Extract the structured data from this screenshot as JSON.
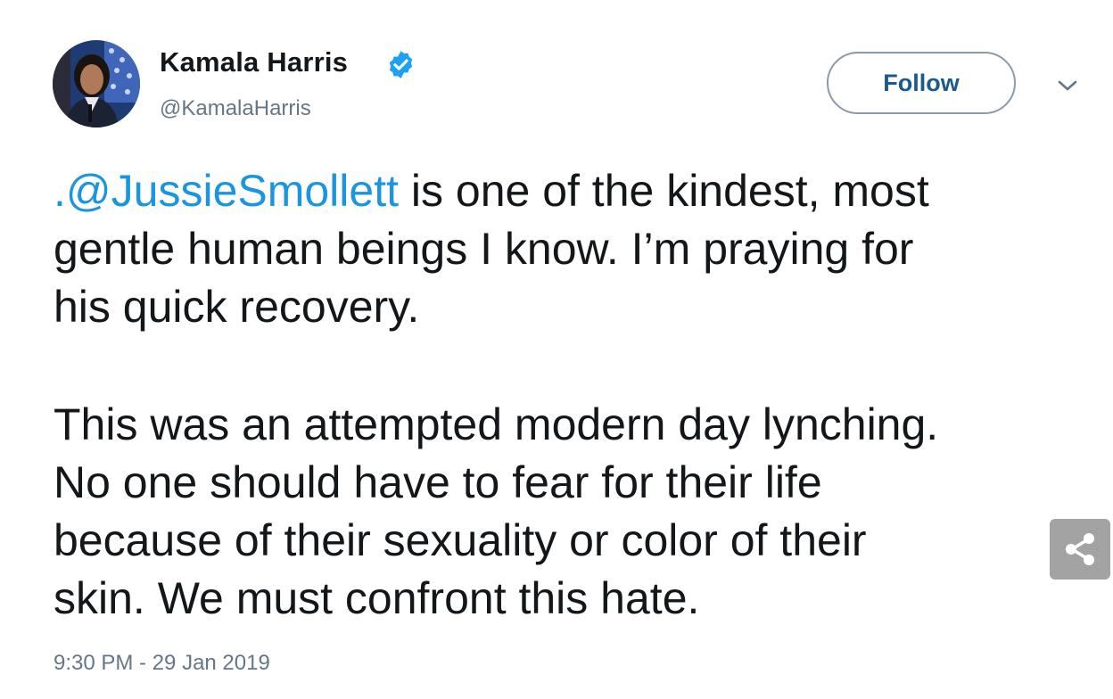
{
  "author": {
    "display_name": "Kamala Harris",
    "handle": "@KamalaHarris",
    "verified": true,
    "avatar_icon": "profile-photo"
  },
  "follow_button": {
    "label": "Follow"
  },
  "menu": {
    "icon": "chevron-down-icon"
  },
  "tweet": {
    "mention": ".@JussieSmollett",
    "line1_rest": " is one of the kindest, most",
    "line2": "gentle human beings I know. I’m praying for",
    "line3": "his quick recovery.",
    "line4": "This was an attempted modern day lynching.",
    "line5": "No one should have to fear for their life",
    "line6": "because of their sexuality or color of their",
    "line7": "skin. We must confront this hate."
  },
  "timestamp": "9:30 PM - 29 Jan 2019",
  "share": {
    "icon": "share-icon"
  },
  "colors": {
    "mention": "#1b95e0",
    "verified": "#1da1f2",
    "handle": "#657786",
    "follow_text": "#1b5a8d",
    "share_bg": "#a3a3a3"
  }
}
